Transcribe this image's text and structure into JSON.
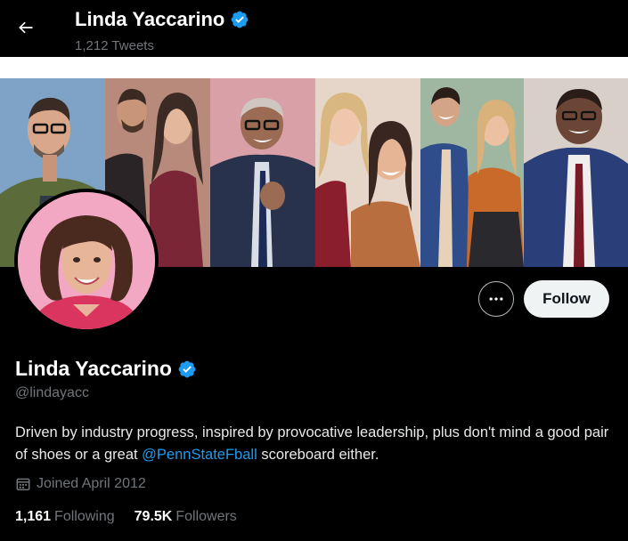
{
  "header": {
    "name": "Linda Yaccarino",
    "tweet_count": "1,212 Tweets"
  },
  "profile": {
    "name": "Linda Yaccarino",
    "handle": "@lindayacc",
    "bio_part1": "Driven by industry progress, inspired by provocative leadership, plus don't mind a good pair of shoes or a great ",
    "bio_mention": "@PennStateFball",
    "bio_part2": " scoreboard either.",
    "joined": "Joined April 2012",
    "following_count": "1,161",
    "following_label": "Following",
    "followers_count": "79.5K",
    "followers_label": "Followers"
  },
  "actions": {
    "more_label": "···",
    "follow_label": "Follow"
  },
  "colors": {
    "background": "#000000",
    "accent": "#1d9bf0",
    "muted": "#71767b",
    "follow_bg": "#eff3f4"
  },
  "icons": {
    "back": "arrow-left-icon",
    "verified": "verified-badge-icon",
    "calendar": "calendar-icon",
    "more": "more-horizontal-icon"
  }
}
